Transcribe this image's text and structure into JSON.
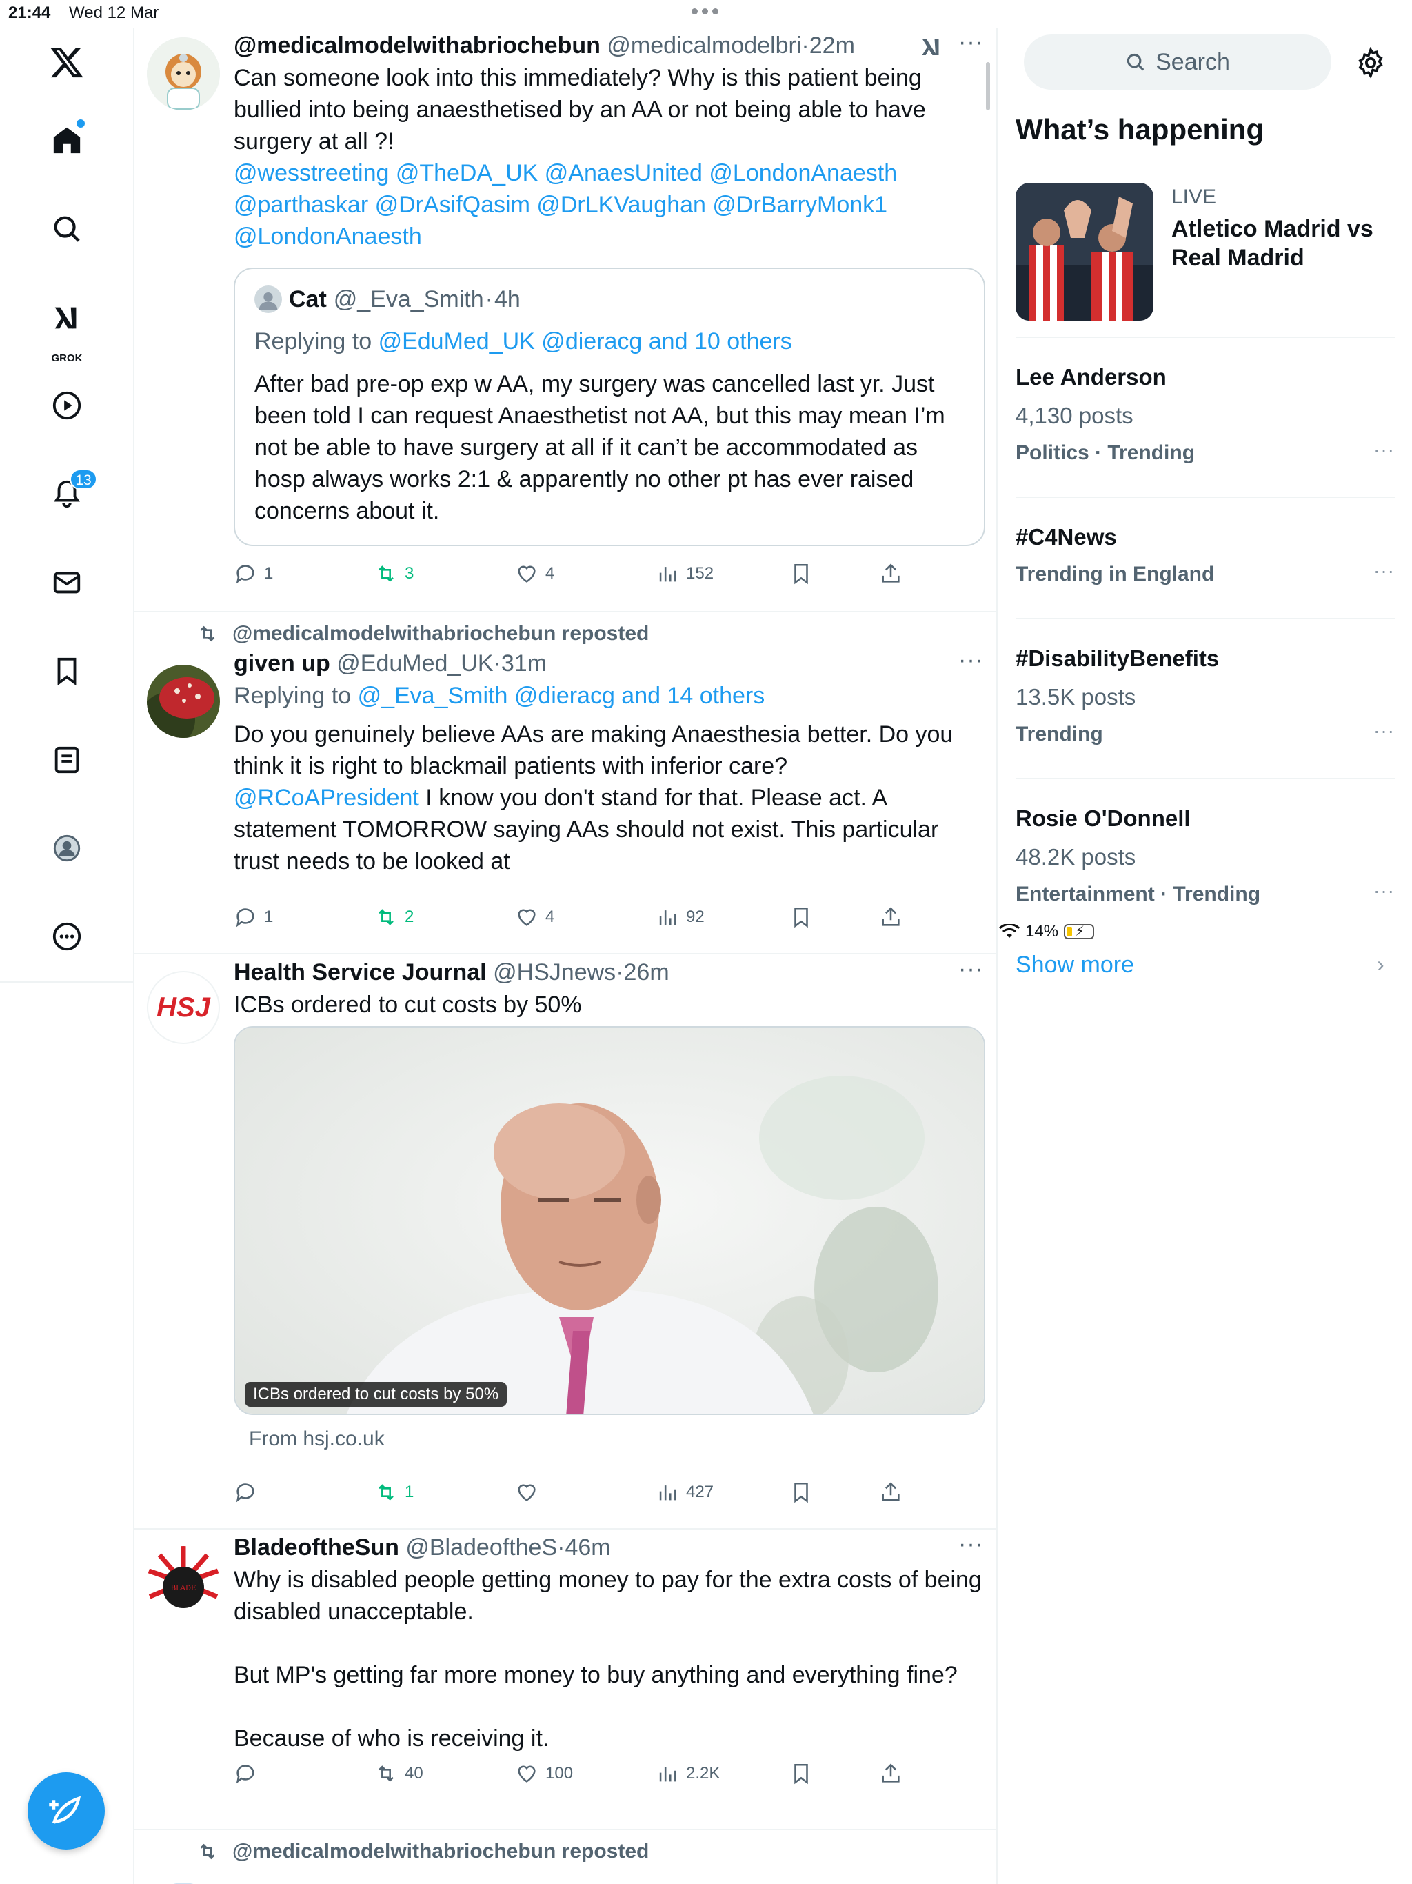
{
  "status_bar": {
    "time": "21:44",
    "date": "Wed 12 Mar",
    "battery": "14%"
  },
  "nav": {
    "notifications_badge": "13",
    "grok_label": "GROK"
  },
  "posts": [
    {
      "name": "@medicalmodelwithabriochebun",
      "handle": "@medicalmodelbri",
      "time": "22m",
      "text": "Can someone look into this immediately? Why is this patient being bullied into being anaesthetised by an AA or not being able to have surgery at all ?!",
      "mentions_line1": "@wesstreeting @TheDA_UK @AnaesUnited @LondonAnaesth",
      "mentions_line2": "@parthaskar @DrAsifQasim @DrLKVaughan @DrBarryMonk1",
      "mentions_line3": "@LondonAnaesth",
      "quote": {
        "name": "Cat",
        "handle": "@_Eva_Smith",
        "time": "4h",
        "replying_prefix": "Replying to",
        "replying_to": "@EduMed_UK @dieracg and 10 others",
        "text": "After bad pre-op exp w AA, my surgery was cancelled last yr. Just been told I can request Anaesthetist not AA, but this may mean I’m not be able to have surgery at all if it can’t be accommodated as hosp always works 2:1 & apparently no other pt has ever raised concerns about it."
      },
      "replies": "1",
      "reposts": "3",
      "likes": "4",
      "views": "152"
    },
    {
      "repost_label": "@medicalmodelwithabriochebun reposted",
      "name": "given up",
      "handle": "@EduMed_UK",
      "time": "31m",
      "replying_prefix": "Replying to",
      "replying_to": "@_Eva_Smith @dieracg and 14 others",
      "text_a": "Do you genuinely believe AAs are making Anaesthesia better. Do you think it is right to blackmail patients with inferior care?",
      "mention": "@RCoAPresident",
      "text_b": " I know you don't stand for that. Please act. A statement TOMORROW saying AAs should not exist. This particular trust needs to be looked at",
      "replies": "1",
      "reposts": "2",
      "likes": "4",
      "views": "92"
    },
    {
      "name": "Health Service Journal",
      "handle": "@HSJnews",
      "time": "26m",
      "text": "ICBs ordered to cut costs by 50%",
      "avatar_text": "HSJ",
      "media_caption": "ICBs ordered to cut costs by 50%",
      "source": "From hsj.co.uk",
      "replies": "",
      "reposts": "1",
      "likes": "",
      "views": "427"
    },
    {
      "name": "BladeoftheSun",
      "handle": "@BladeoftheS",
      "time": "46m",
      "text": "Why is disabled people getting money to pay for the extra costs of being disabled unacceptable.\n\nBut MP's getting far more money to buy anything and everything fine?\n\nBecause of who is receiving it.",
      "replies": "",
      "reposts": "40",
      "likes": "100",
      "views": "2.2K"
    },
    {
      "repost_label": "@medicalmodelwithabriochebun reposted"
    }
  ],
  "sidebar": {
    "search_placeholder": "Search",
    "whats_happening": "What’s happening",
    "live": {
      "label": "LIVE",
      "title": "Atletico Madrid vs Real Madrid"
    },
    "trends": [
      {
        "name": "Lee Anderson",
        "posts": "4,130 posts",
        "context": "Politics · Trending"
      },
      {
        "name": "#C4News",
        "posts": "",
        "context": "Trending in England"
      },
      {
        "name": "#DisabilityBenefits",
        "posts": "13.5K posts",
        "context": "Trending"
      },
      {
        "name": "Rosie O'Donnell",
        "posts": "48.2K posts",
        "context": "Entertainment · Trending"
      }
    ],
    "show_more": "Show more"
  },
  "colors": {
    "accent": "#1d9bf0",
    "repost_green": "#00ba7c",
    "muted": "#536471",
    "border": "#eff3f4"
  },
  "icons": [
    "x-logo-icon",
    "home-icon",
    "search-icon",
    "grok-icon",
    "video-icon",
    "bell-icon",
    "mail-icon",
    "bookmark-icon",
    "list-icon",
    "profile-icon",
    "more-icon",
    "compose-icon",
    "reply-icon",
    "repost-icon",
    "like-icon",
    "views-icon",
    "share-icon",
    "gear-icon"
  ]
}
